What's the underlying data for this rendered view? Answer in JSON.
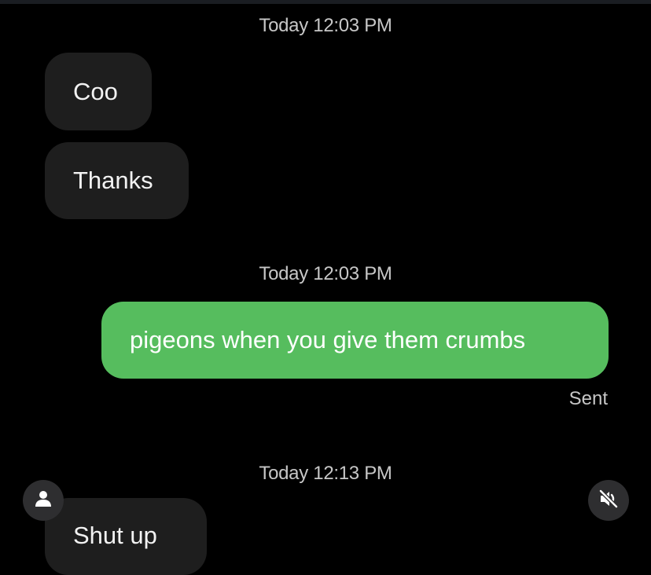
{
  "conversation": {
    "groups": [
      {
        "timestamp": "Today 12:03 PM",
        "incoming": [
          "Coo",
          "Thanks"
        ]
      },
      {
        "timestamp": "Today 12:03 PM",
        "outgoing": "pigeons when you give them crumbs",
        "status": "Sent"
      },
      {
        "timestamp": "Today 12:13 PM",
        "incoming": [
          "Shut up"
        ]
      }
    ]
  },
  "controls": {
    "avatar_icon": "person-icon",
    "mute_icon": "volume-muted-icon"
  },
  "colors": {
    "background": "#000000",
    "incoming_bubble": "#1e1e1e",
    "outgoing_bubble": "#56bd5e",
    "timestamp_text": "#c7c7c7"
  }
}
